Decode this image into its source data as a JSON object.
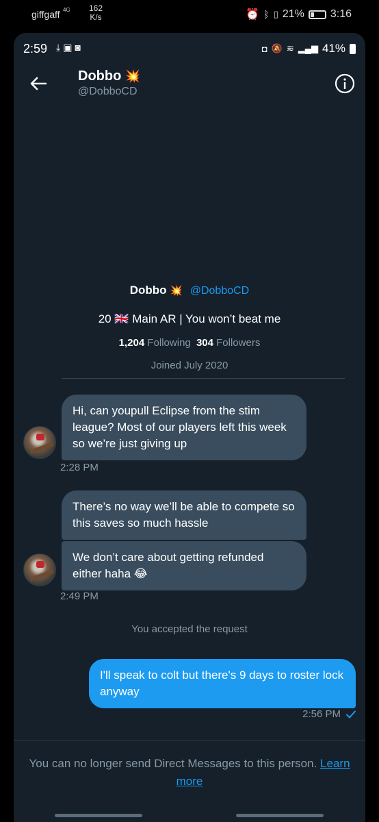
{
  "device_status": {
    "carrier": "giffgaff",
    "network": "4G",
    "speed_value": "162",
    "speed_unit": "K/s",
    "battery_percent": "21%",
    "time": "3:16"
  },
  "app_status": {
    "time": "2:59",
    "battery_percent": "41%"
  },
  "header": {
    "name": "Dobbo",
    "name_emoji": "💥",
    "handle": "@DobboCD"
  },
  "profile": {
    "name": "Dobbo",
    "name_emoji": "💥",
    "handle": "@DobboCD",
    "bio": "20 🇬🇧 Main AR | You won’t beat me",
    "following_count": "1,204",
    "following_label": "Following",
    "followers_count": "304",
    "followers_label": "Followers",
    "joined": "Joined July 2020"
  },
  "messages": [
    {
      "text": "Hi, can youpull Eclipse from the stim league? Most of our players left this week so we’re just giving up",
      "time": "2:28 PM"
    },
    {
      "text": "There’s no way we’ll be able to compete so this saves so much hassle"
    },
    {
      "text": "We don’t care about getting refunded either haha 😂",
      "time": "2:49 PM"
    }
  ],
  "system_message": "You accepted the request",
  "outgoing": {
    "text": "I'll speak to colt but there's 9 days to roster lock anyway",
    "time": "2:56 PM"
  },
  "footer": {
    "notice": "You can no longer send Direct Messages to this person.",
    "link": "Learn more"
  },
  "colors": {
    "background": "#15202b",
    "incoming_bubble": "#3a4d5e",
    "outgoing_bubble": "#1d9bf0",
    "secondary_text": "#8899a6",
    "accent": "#1d9bf0"
  }
}
